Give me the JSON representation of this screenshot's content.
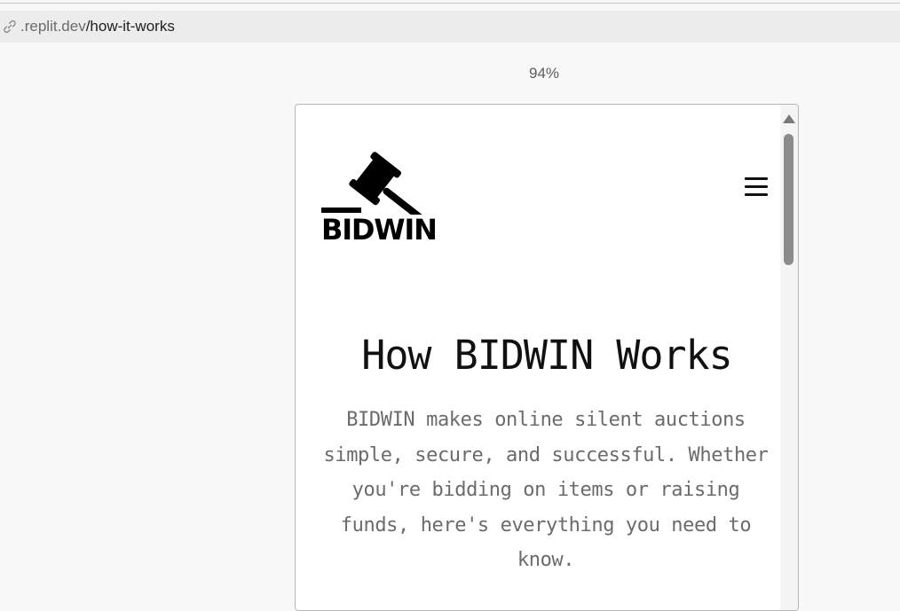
{
  "address_bar": {
    "domain": ".replit.dev",
    "path": "/how-it-works"
  },
  "zoom_level": "94%",
  "site": {
    "logo_text": "BIDWIN",
    "heading": "How BIDWIN Works",
    "intro": "BIDWIN makes online silent auctions simple, secure, and successful. Whether you're bidding on items or raising funds, here's everything you need to know."
  },
  "icons": {
    "link": "link-icon",
    "logo": "gavel-icon",
    "menu": "hamburger-menu-icon",
    "scroll_up": "scroll-up-arrow-icon"
  },
  "colors": {
    "text_primary": "#111111",
    "text_muted": "#6b6b6b",
    "address_bar_bg": "#ececec"
  }
}
